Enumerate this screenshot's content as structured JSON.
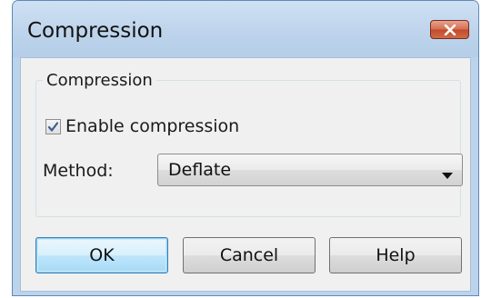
{
  "window": {
    "title": "Compression",
    "close_icon": "close-x-icon",
    "accent_color": "#c24a2b"
  },
  "group": {
    "legend": "Compression",
    "enable_checkbox": {
      "label": "Enable compression",
      "checked": true
    },
    "method": {
      "label": "Method:",
      "selected": "Deflate"
    }
  },
  "buttons": {
    "ok": "OK",
    "cancel": "Cancel",
    "help": "Help"
  }
}
